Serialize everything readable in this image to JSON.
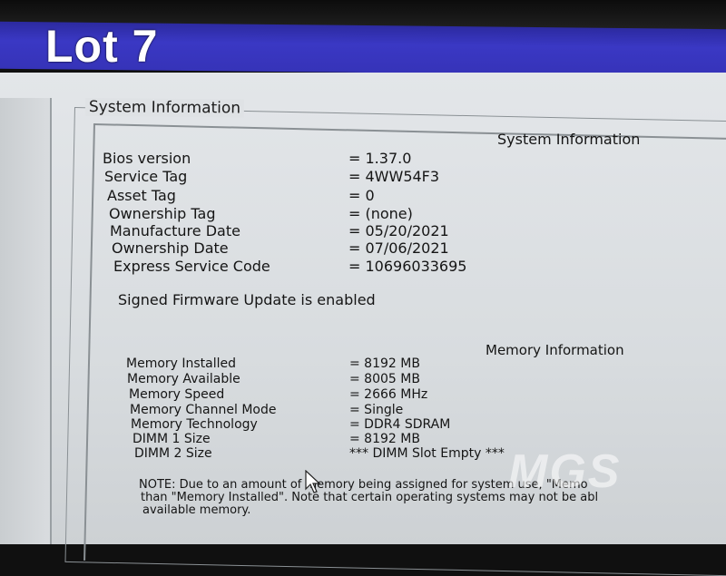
{
  "overlay": {
    "lot_label": "Lot 7",
    "watermark": "MGS"
  },
  "group_title": "System Information",
  "section_header": "System Information",
  "system_info": [
    {
      "label": "Bios version",
      "value": "= 1.37.0"
    },
    {
      "label": "Service Tag",
      "value": "= 4WW54F3"
    },
    {
      "label": "Asset Tag",
      "value": "= 0"
    },
    {
      "label": "Ownership Tag",
      "value": "= (none)"
    },
    {
      "label": "Manufacture Date",
      "value": "= 05/20/2021"
    },
    {
      "label": "Ownership Date",
      "value": "= 07/06/2021"
    },
    {
      "label": "Express Service Code",
      "value": "= 10696033695"
    }
  ],
  "firmware_status": "Signed Firmware Update is enabled",
  "memory_header": "Memory Information",
  "memory_info": [
    {
      "label": "Memory Installed",
      "value": "= 8192 MB"
    },
    {
      "label": "Memory Available",
      "value": "= 8005 MB"
    },
    {
      "label": "Memory Speed",
      "value": "= 2666 MHz"
    },
    {
      "label": "Memory Channel Mode",
      "value": "= Single"
    },
    {
      "label": "Memory Technology",
      "value": "= DDR4 SDRAM"
    },
    {
      "label": "DIMM 1 Size",
      "value": "= 8192 MB"
    },
    {
      "label": "DIMM 2 Size",
      "value": "*** DIMM Slot Empty ***"
    }
  ],
  "note_lines": [
    "NOTE: Due to an amount of memory being assigned for system use, \"Memo",
    "than \"Memory Installed\". Note that certain operating systems may not be abl",
    "available memory."
  ]
}
